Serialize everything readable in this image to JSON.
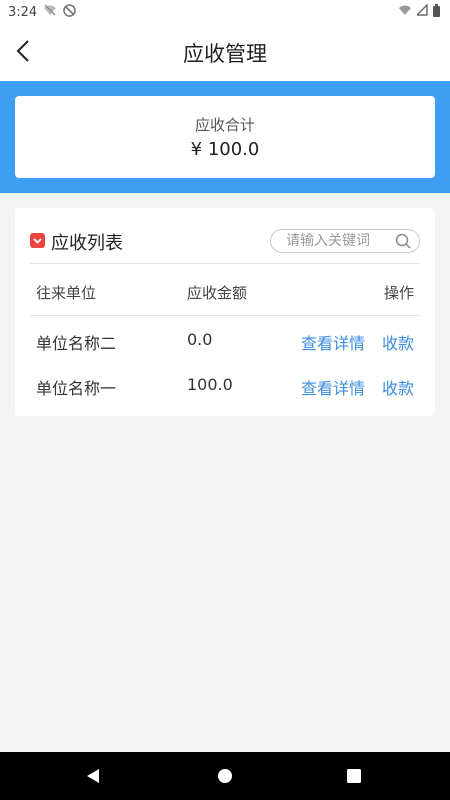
{
  "status_bar": {
    "time": "3:24"
  },
  "header": {
    "title": "应收管理"
  },
  "summary": {
    "label": "应收合计",
    "amount": "¥ 100.0"
  },
  "list": {
    "title": "应收列表",
    "search_placeholder": "请输入关键词",
    "columns": [
      "往来单位",
      "应收金额",
      "操作"
    ],
    "rows": [
      {
        "unit": "单位名称二",
        "amount": "0.0",
        "detail": "查看详情",
        "collect": "收款"
      },
      {
        "unit": "单位名称一",
        "amount": "100.0",
        "detail": "查看详情",
        "collect": "收款"
      }
    ]
  },
  "colors": {
    "accent": "#3d9ef4",
    "link": "#3d8ee0",
    "badge": "#e8463f"
  }
}
